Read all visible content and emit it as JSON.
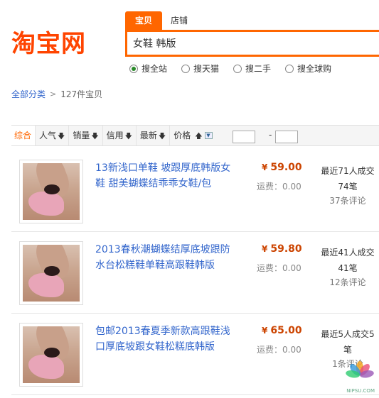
{
  "logo": "淘宝网",
  "search": {
    "tabs": [
      "宝贝",
      "店铺"
    ],
    "query": "女鞋 韩版",
    "scopes": [
      {
        "label": "搜全站",
        "selected": true
      },
      {
        "label": "搜天猫",
        "selected": false
      },
      {
        "label": "搜二手",
        "selected": false
      },
      {
        "label": "搜全球购",
        "selected": false
      }
    ]
  },
  "breadcrumb": {
    "all": "全部分类",
    "separator": ">",
    "count": "127件宝贝"
  },
  "sortbar": {
    "default": "综合",
    "popularity": "人气",
    "sales": "销量",
    "credit": "信用",
    "newest": "最新",
    "price": "价格",
    "range_sep": "-"
  },
  "items": [
    {
      "title": "13新浅口单鞋 坡跟厚底韩版女鞋 甜美蝴蝶结乖乖女鞋/包",
      "price": "59.00",
      "currency": "¥",
      "shipping": "运费：0.00",
      "sales": "最近71人成交74笔",
      "reviews": "37条评论"
    },
    {
      "title": "2013春秋潮蝴蝶结厚底坡跟防水台松糕鞋单鞋高跟鞋韩版",
      "price": "59.80",
      "currency": "¥",
      "shipping": "运费：0.00",
      "sales": "最近41人成交41笔",
      "reviews": "12条评论"
    },
    {
      "title": "包邮2013春夏季新款高跟鞋浅口厚底坡跟女鞋松糕底韩版",
      "price": "65.00",
      "currency": "¥",
      "shipping": "运费：0.00",
      "sales": "最近5人成交5笔",
      "reviews": "1条评论"
    }
  ],
  "watermark": "NIPSU.COM",
  "colors": {
    "accent": "#ff6600",
    "price": "#cc4400",
    "link": "#3366cc"
  }
}
